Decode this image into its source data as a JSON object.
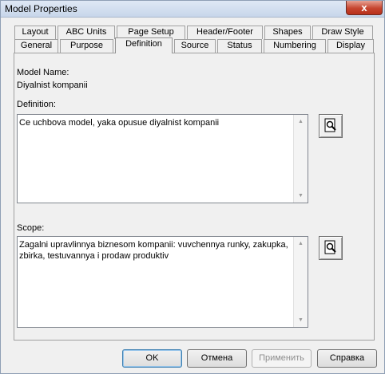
{
  "window": {
    "title": "Model Properties",
    "close_symbol": "x"
  },
  "tabs_row1": [
    {
      "label": "Layout"
    },
    {
      "label": "ABC Units"
    },
    {
      "label": "Page Setup"
    },
    {
      "label": "Header/Footer"
    },
    {
      "label": "Shapes"
    },
    {
      "label": "Draw Style"
    }
  ],
  "tabs_row2": [
    {
      "label": "General"
    },
    {
      "label": "Purpose"
    },
    {
      "label": "Definition",
      "active": true
    },
    {
      "label": "Source"
    },
    {
      "label": "Status"
    },
    {
      "label": "Numbering"
    },
    {
      "label": "Display"
    }
  ],
  "model_name": {
    "label": "Model Name:",
    "value": "Diyalnist kompanii"
  },
  "definition": {
    "label": "Definition:",
    "value": "Ce uchbova model, yaka opusue diyalnist kompanii"
  },
  "scope": {
    "label": "Scope:",
    "value": "Zagalni upravlinnya biznesom kompanii: vuvchennya runky, zakupka,\nzbirka, testuvannya i prodaw produktiv"
  },
  "buttons": {
    "ok": "OK",
    "cancel": "Отмена",
    "apply": "Применить",
    "help": "Справка"
  }
}
